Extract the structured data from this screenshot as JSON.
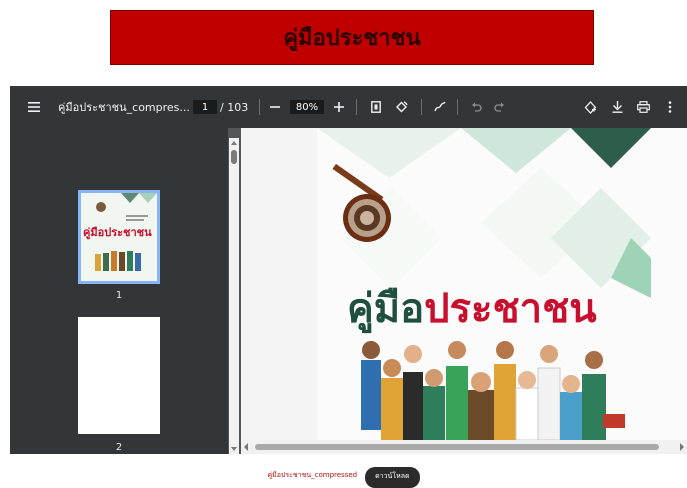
{
  "banner": {
    "title": "คู่มือประชาชน"
  },
  "toolbar": {
    "menu_icon": "hamburger-menu-icon",
    "document_title": "คู่มือประชาชน_compres...",
    "current_page": "1",
    "total_pages": "/ 103",
    "zoom": "80%"
  },
  "sidebar": {
    "thumbnails": [
      {
        "label": "1",
        "title_text": "คู่มือประชาชน",
        "selected": true
      },
      {
        "label": "2",
        "selected": false
      }
    ]
  },
  "page": {
    "cover_title_black": "คู่มือ",
    "cover_title_red": "ประชาชน"
  },
  "footer": {
    "file_name": "คู่มือประชาชน_compressed",
    "download_label": "ดาวน์โหลด"
  },
  "colors": {
    "banner_bg": "#c00000",
    "toolbar_bg": "#323639",
    "sidebar_bg": "#323639",
    "selected_thumb_border": "#8ab4f8",
    "cover_red": "#c8102e",
    "cover_green": "#2e7d5b"
  }
}
